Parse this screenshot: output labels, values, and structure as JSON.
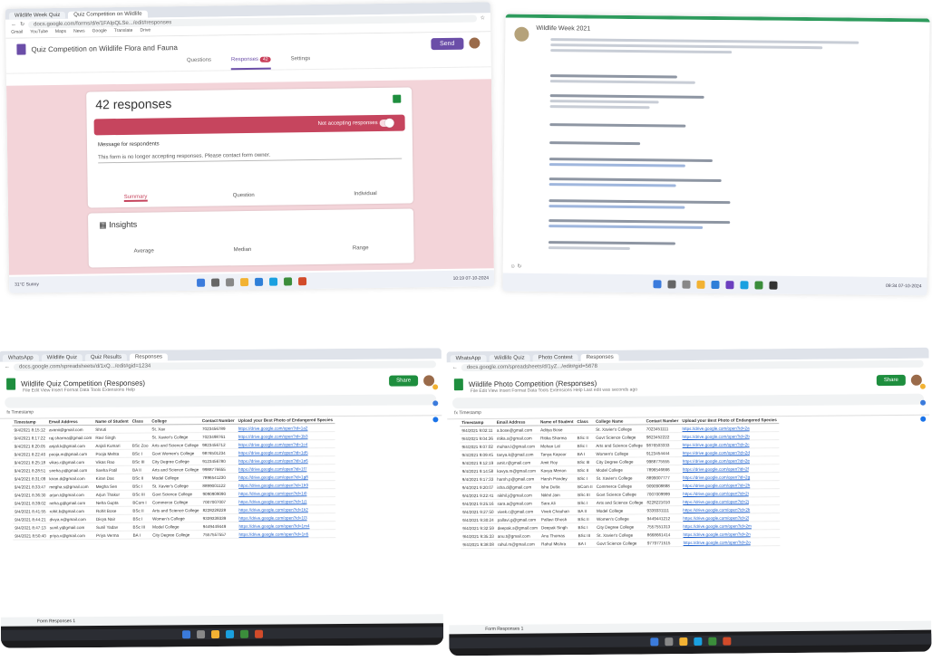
{
  "q1": {
    "tabs": [
      "Wildlife Week Quiz",
      "Quiz Competition on Wildlife"
    ],
    "url": "docs.google.com/forms/d/e/1FAIpQLSe.../edit#responses",
    "bookmarks": [
      "Gmail",
      "YouTube",
      "Maps",
      "News",
      "Google",
      "Translate",
      "Drive"
    ],
    "form_title": "Quiz Competition on Wildlife Flora and Fauna",
    "send_label": "Send",
    "tabs_form": [
      "Questions",
      "Responses",
      "Settings"
    ],
    "responses_badge": "42",
    "responses_title": "42 responses",
    "accepting": "Not accepting responses",
    "message_label": "Message for respondents",
    "message_text": "This form is no longer accepting responses. Please contact form owner.",
    "view_tabs": [
      "Summary",
      "Question",
      "Individual"
    ],
    "insights_title": "Insights",
    "insight_labels": [
      "Average",
      "Median",
      "Range"
    ],
    "taskbar_left": "31°C Sunny",
    "taskbar_right": "10:19 07-10-2024"
  },
  "q2": {
    "title": "Wildlife Week 2021",
    "taskbar_right": "09:34 07-10-2024",
    "taskbar_left": "28°C"
  },
  "q3": {
    "tabs": [
      "WhatsApp",
      "Wildlife Quiz",
      "Quiz Results",
      "Responses"
    ],
    "url": "docs.google.com/spreadsheets/d/1xQ.../edit#gid=1234",
    "title": "Wildlife Quiz Competition (Responses)",
    "menus": "File Edit View Insert Format Data Tools Extensions Help",
    "share_label": "Share",
    "fx": "Timestamp",
    "headers": [
      "Timestamp",
      "Email Address",
      "Name of Student",
      "Class",
      "College",
      "Contact Number",
      "Upload your Best Photo of Endangered Species"
    ],
    "rows": [
      [
        "9/4/2021 8:15:12",
        "avanii@gmail.com",
        "Shruti",
        "",
        "St. Xav",
        "7023456789",
        "https://drive.google.com/open?id=1a2"
      ],
      [
        "9/4/2021 8:17:22",
        "raj.sharma@gmail.com",
        "Ravi Singh",
        "",
        "St. Xavier's College",
        "7023498761",
        "https://drive.google.com/open?id=1b3"
      ],
      [
        "9/4/2021 8:20:05",
        "anjali.k@gmail.com",
        "Anjali Kumari",
        "BSc Zoo",
        "Arts and Science College",
        "9823456712",
        "https://drive.google.com/open?id=1c4"
      ],
      [
        "9/4/2021 8:22:40",
        "pooja.m@gmail.com",
        "Pooja Mehta",
        "BSc I",
        "Govt Women's College",
        "9876501234",
        "https://drive.google.com/open?id=1d5"
      ],
      [
        "9/4/2021 8:25:18",
        "vikas.r@gmail.com",
        "Vikas Rao",
        "BSc III",
        "City Degree College",
        "9123456780",
        "https://drive.google.com/open?id=1e6"
      ],
      [
        "9/4/2021 8:28:51",
        "sneha.p@gmail.com",
        "Sneha Patil",
        "BA II",
        "Arts and Science College",
        "9988776655",
        "https://drive.google.com/open?id=1f7"
      ],
      [
        "9/4/2021 8:31:09",
        "kiran.d@gmail.com",
        "Kiran Das",
        "BSc II",
        "Model College",
        "7896541230",
        "https://drive.google.com/open?id=1g8"
      ],
      [
        "9/4/2021 8:33:47",
        "megha.s@gmail.com",
        "Megha Sen",
        "BSc I",
        "St. Xavier's College",
        "8899001122",
        "https://drive.google.com/open?id=1h9"
      ],
      [
        "9/4/2021 8:36:30",
        "arjun.t@gmail.com",
        "Arjun Thakur",
        "BSc III",
        "Govt Science College",
        "9090909090",
        "https://drive.google.com/open?id=1i0"
      ],
      [
        "9/4/2021 8:39:02",
        "neha.g@gmail.com",
        "Neha Gupta",
        "BCom I",
        "Commerce College",
        "7007007007",
        "https://drive.google.com/open?id=1j1"
      ],
      [
        "9/4/2021 8:41:55",
        "rohit.b@gmail.com",
        "Rohit Bose",
        "BSc II",
        "Arts and Science College",
        "8228228228",
        "https://drive.google.com/open?id=1k2"
      ],
      [
        "9/4/2021 8:44:21",
        "divya.n@gmail.com",
        "Divya Nair",
        "BSc I",
        "Women's College",
        "9339339339",
        "https://drive.google.com/open?id=1l3"
      ],
      [
        "9/4/2021 8:47:13",
        "sunil.y@gmail.com",
        "Sunil Yadav",
        "BSc III",
        "Model College",
        "9449449449",
        "https://drive.google.com/open?id=1m4"
      ],
      [
        "9/4/2021 8:50:40",
        "priya.v@gmail.com",
        "Priya Verma",
        "BA I",
        "City Degree College",
        "7557557557",
        "https://drive.google.com/open?id=1n5"
      ]
    ],
    "sheet_tab": "Form Responses 1"
  },
  "q4": {
    "tabs": [
      "WhatsApp",
      "Wildlife Quiz",
      "Photo Contest",
      "Responses"
    ],
    "url": "docs.google.com/spreadsheets/d/1yZ.../edit#gid=5678",
    "title": "Wildlife Photo Competition (Responses)",
    "menus": "File Edit View Insert Format Data Tools Extensions Help  Last edit was seconds ago",
    "share_label": "Share",
    "fx": "Timestamp",
    "headers": [
      "Timestamp",
      "Email Address",
      "Name of Student",
      "Class",
      "College Name",
      "Contact Number",
      "Upload your Best Photo of Endangered Species"
    ],
    "rows": [
      [
        "9/4/2021 9:02:11",
        "a.bose@gmail.com",
        "Aditya Bose",
        "",
        "St. Xavier's College",
        "7023451111",
        "https://drive.google.com/open?id=2a"
      ],
      [
        "9/4/2021 9:04:36",
        "ritika.s@gmail.com",
        "Ritika Sharma",
        "BSc II",
        "Govt Science College",
        "9823452222",
        "https://drive.google.com/open?id=2b"
      ],
      [
        "9/4/2021 9:07:02",
        "mohan.l@gmail.com",
        "Mohan Lal",
        "BSc I",
        "Arts and Science College",
        "9876503333",
        "https://drive.google.com/open?id=2c"
      ],
      [
        "9/4/2021 9:09:45",
        "tanya.k@gmail.com",
        "Tanya Kapoor",
        "BA I",
        "Women's College",
        "9123454444",
        "https://drive.google.com/open?id=2d"
      ],
      [
        "9/4/2021 9:12:19",
        "amit.r@gmail.com",
        "Amit Roy",
        "BSc III",
        "City Degree College",
        "9988775555",
        "https://drive.google.com/open?id=2e"
      ],
      [
        "9/4/2021 9:14:58",
        "kavya.m@gmail.com",
        "Kavya Menon",
        "BSc II",
        "Model College",
        "7896546666",
        "https://drive.google.com/open?id=2f"
      ],
      [
        "9/4/2021 9:17:33",
        "harsh.p@gmail.com",
        "Harsh Pandey",
        "BSc I",
        "St. Xavier's College",
        "8899007777",
        "https://drive.google.com/open?id=2g"
      ],
      [
        "9/4/2021 9:20:07",
        "isha.d@gmail.com",
        "Isha Dutta",
        "BCom II",
        "Commerce College",
        "9090908888",
        "https://drive.google.com/open?id=2h"
      ],
      [
        "9/4/2021 9:22:41",
        "nikhil.j@gmail.com",
        "Nikhil Jain",
        "BSc III",
        "Govt Science College",
        "7007009999",
        "https://drive.google.com/open?id=2i"
      ],
      [
        "9/4/2021 9:25:16",
        "sara.a@gmail.com",
        "Sara Ali",
        "BSc I",
        "Arts and Science College",
        "8228221010",
        "https://drive.google.com/open?id=2j"
      ],
      [
        "9/4/2021 9:27:50",
        "vivek.c@gmail.com",
        "Vivek Chauhan",
        "BA II",
        "Model College",
        "9339331111",
        "https://drive.google.com/open?id=2k"
      ],
      [
        "9/4/2021 9:30:24",
        "pallavi.g@gmail.com",
        "Pallavi Ghosh",
        "BSc II",
        "Women's College",
        "9449441212",
        "https://drive.google.com/open?id=2l"
      ],
      [
        "9/4/2021 9:32:59",
        "deepak.s@gmail.com",
        "Deepak Singh",
        "BSc I",
        "City Degree College",
        "7557551313",
        "https://drive.google.com/open?id=2m"
      ],
      [
        "9/4/2021 9:35:33",
        "anu.t@gmail.com",
        "Anu Thomas",
        "BSc III",
        "St. Xavier's College",
        "8668661414",
        "https://drive.google.com/open?id=2n"
      ],
      [
        "9/4/2021 9:38:08",
        "rahul.m@gmail.com",
        "Rahul Mishra",
        "BA I",
        "Govt Science College",
        "9779771515",
        "https://drive.google.com/open?id=2o"
      ]
    ],
    "sheet_tab": "Form Responses 1"
  },
  "colors": {
    "form_purple": "#6b4ea8",
    "banner_red": "#c6455e",
    "sheets_green": "#1e8e3e",
    "doc_green": "#2e9b5d",
    "pink_bg": "#f3d4d9"
  }
}
